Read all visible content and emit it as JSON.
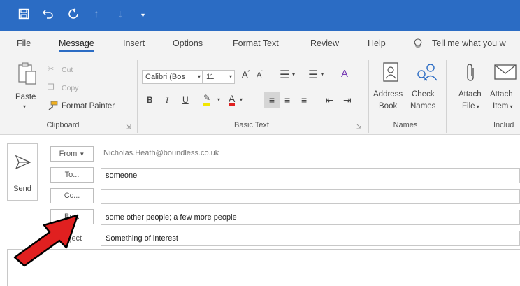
{
  "tabs": [
    "File",
    "Message",
    "Insert",
    "Options",
    "Format Text",
    "Review",
    "Help"
  ],
  "active_tab": "Message",
  "tell_me": "Tell me what you w",
  "clipboard": {
    "paste": "Paste",
    "cut": "Cut",
    "copy": "Copy",
    "format_painter": "Format Painter",
    "group_label": "Clipboard"
  },
  "basic_text": {
    "font_name": "Calibri (Bos",
    "font_size": "11",
    "bold": "B",
    "italic": "I",
    "underline": "U",
    "group_label": "Basic Text"
  },
  "names": {
    "address_book_1": "Address",
    "address_book_2": "Book",
    "check_names_1": "Check",
    "check_names_2": "Names",
    "group_label": "Names"
  },
  "include": {
    "attach_file_1": "Attach",
    "attach_file_2": "File",
    "attach_item_1": "Attach",
    "attach_item_2": "Item",
    "group_label": "Includ"
  },
  "compose": {
    "send": "Send",
    "from_label": "From",
    "from_value": "Nicholas.Heath@boundless.co.uk",
    "to_label": "To...",
    "to_value": "someone",
    "cc_label": "Cc...",
    "cc_value": "",
    "bcc_label": "Bc...",
    "bcc_value": "some other people; a few more people",
    "subject_label": "ject",
    "subject_value": "Something of interest"
  },
  "colors": {
    "titlebar": "#2b6cc4",
    "ribbon_bg": "#f3f3f3",
    "arrow_fill": "#e02020"
  }
}
